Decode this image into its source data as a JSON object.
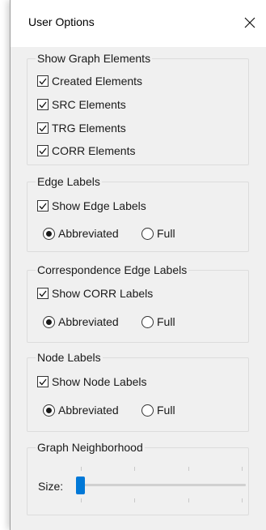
{
  "window": {
    "title": "User Options"
  },
  "graph_elements": {
    "legend": "Show Graph Elements",
    "items": [
      {
        "label": "Created Elements",
        "checked": true
      },
      {
        "label": "SRC Elements",
        "checked": true
      },
      {
        "label": "TRG Elements",
        "checked": true
      },
      {
        "label": "CORR Elements",
        "checked": true
      }
    ]
  },
  "edge_labels": {
    "legend": "Edge Labels",
    "show_label": "Show Edge Labels",
    "abbreviated": "Abbreviated",
    "full": "Full",
    "selected": "Abbreviated"
  },
  "corr_edge_labels": {
    "legend": "Correspondence Edge Labels",
    "show_label": "Show CORR Labels",
    "abbreviated": "Abbreviated",
    "full": "Full",
    "selected": "Abbreviated"
  },
  "node_labels": {
    "legend": "Node Labels",
    "show_label": "Show Node Labels",
    "abbreviated": "Abbreviated",
    "full": "Full",
    "selected": "Abbreviated"
  },
  "neighborhood": {
    "legend": "Graph Neighborhood",
    "size_label": "Size:",
    "size_value_fraction": 0.0
  },
  "colors": {
    "accent": "#0078d7",
    "background": "#f0f0f0"
  }
}
